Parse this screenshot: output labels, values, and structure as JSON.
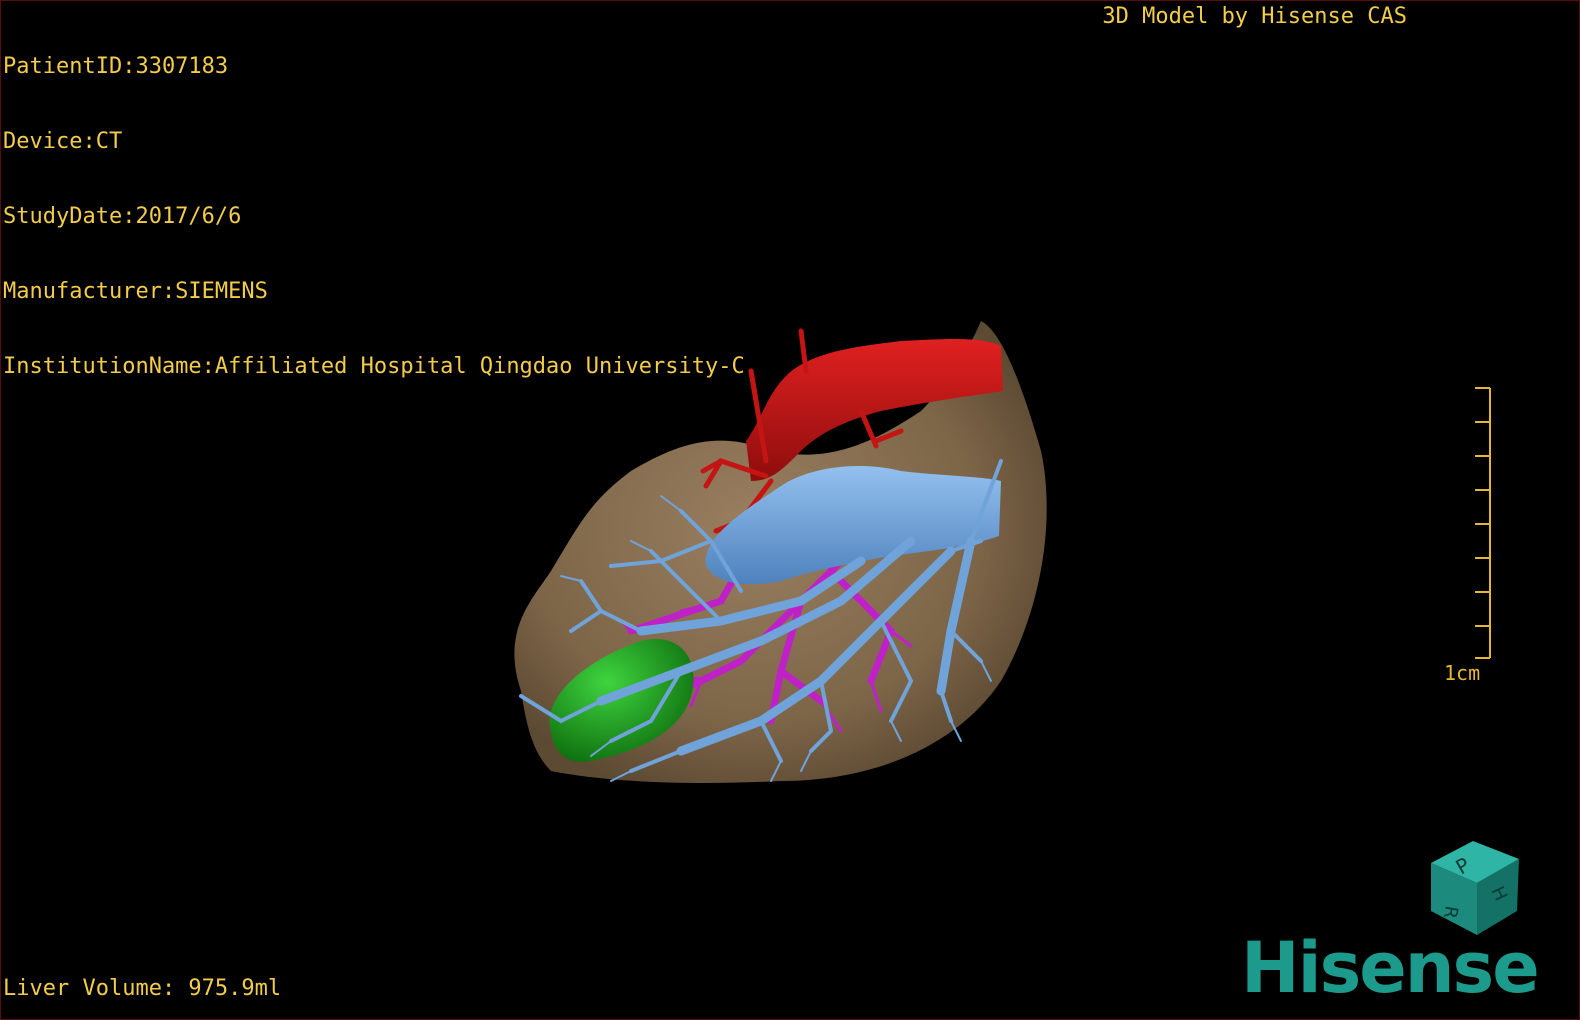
{
  "patient_info": {
    "patient_id": "PatientID:3307183",
    "device": "Device:CT",
    "study_date": "StudyDate:2017/6/6",
    "manufacturer": "Manufacturer:SIEMENS",
    "institution": "InstitutionName:Affiliated Hospital Qingdao University-C"
  },
  "branding": {
    "title": "3D Model by Hisense CAS",
    "logo_text": "Hisense",
    "cube_faces": [
      "P",
      "H",
      "R"
    ]
  },
  "measurements": {
    "liver_volume": "Liver Volume: 975.9ml",
    "scale_label": "1cm"
  },
  "colors": {
    "overlay_text": "#f2cc4a",
    "scale": "#e6b82e",
    "liver": "#8c7355",
    "artery": "#c41414",
    "portal_vein": "#c020c8",
    "hepatic_vein": "#6fa3d9",
    "gallbladder": "#1c9c1c",
    "brand": "#1c9a8c"
  },
  "icons": {
    "orientation_cube": "orientation-cube-icon",
    "scale_bar": "ruler-scale-icon"
  }
}
